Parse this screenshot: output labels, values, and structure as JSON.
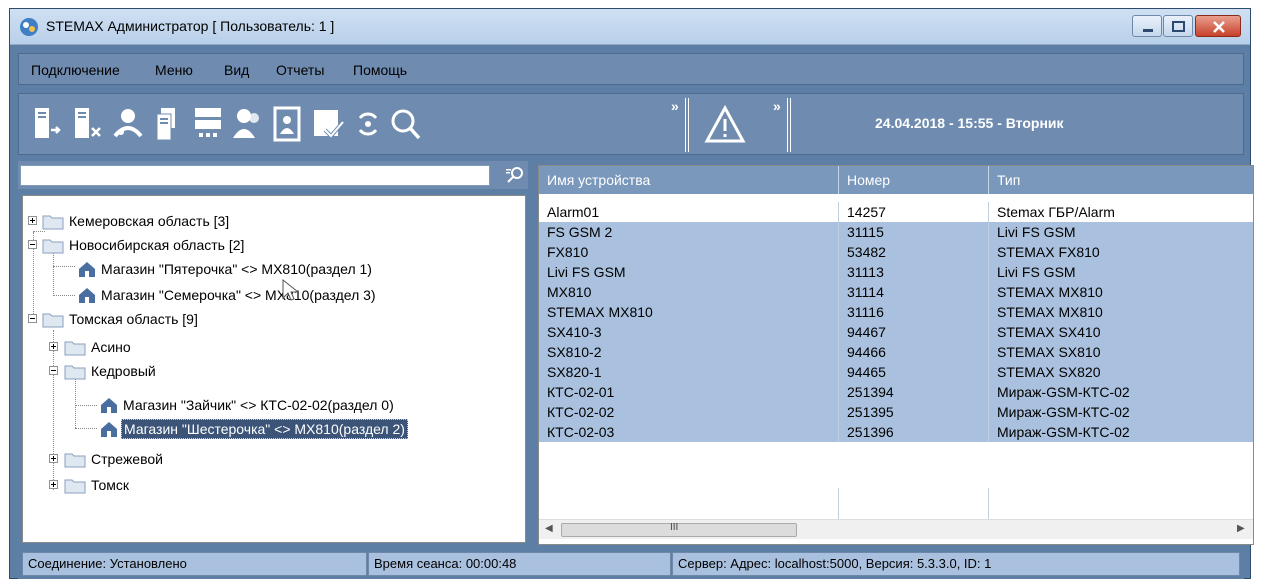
{
  "window": {
    "title": "STEMAX Администратор [ Пользователь: 1 ]"
  },
  "menu": [
    "Подключение",
    "Меню",
    "Вид",
    "Отчеты",
    "Помощь"
  ],
  "toolbar": {
    "datetime": "24.04.2018 - 15:55 - Вторник",
    "chevron": "»",
    "icons": [
      "connect-icon",
      "disconnect-icon",
      "users-icon",
      "documents-icon",
      "server-list-icon",
      "user-icon",
      "report-icon",
      "checklist-icon",
      "refresh-icon",
      "search-icon",
      "alarm-icon"
    ]
  },
  "search": {
    "value": ""
  },
  "tree": {
    "nodes": [
      {
        "label": "Кемеровская область [3]",
        "expanded": false
      },
      {
        "label": "Новосибирская область [2]",
        "expanded": true
      },
      {
        "label": "Магазин \"Пятерочка\" <> MX810(раздел 1)"
      },
      {
        "label": "Магазин \"Семерочка\" <> MX810(раздел 3)"
      },
      {
        "label": "Томская область [9]",
        "expanded": true
      },
      {
        "label": "Асино",
        "expanded": false
      },
      {
        "label": "Кедровый",
        "expanded": true
      },
      {
        "label": "Магазин \"Зайчик\" <> КТС-02-02(раздел 0)"
      },
      {
        "label": "Магазин \"Шестерочка\" <> MX810(раздел 2)",
        "selected": true
      },
      {
        "label": "Стрежевой",
        "expanded": false
      },
      {
        "label": "Томск",
        "expanded": false
      }
    ]
  },
  "table": {
    "columns": [
      "Имя устройства",
      "Номер",
      "Тип"
    ],
    "rows": [
      [
        "Alarm01",
        "14257",
        "Stemax ГБР/Alarm"
      ],
      [
        "FS GSM 2",
        "31115",
        "Livi FS GSM"
      ],
      [
        "FX810",
        "53482",
        "STEMAX FX810"
      ],
      [
        "Livi FS GSM",
        "31113",
        "Livi FS GSM"
      ],
      [
        "MX810",
        "31114",
        "STEMAX MX810"
      ],
      [
        "STEMAX MX810",
        "31116",
        "STEMAX MX810"
      ],
      [
        "SX410-3",
        "94467",
        "STEMAX SX410"
      ],
      [
        "SX810-2",
        "94466",
        "STEMAX SX810"
      ],
      [
        "SX820-1",
        "94465",
        "STEMAX SX820"
      ],
      [
        "КТС-02-01",
        "251394",
        "Мираж-GSM-КТС-02"
      ],
      [
        "КТС-02-02",
        "251395",
        "Мираж-GSM-КТС-02"
      ],
      [
        "КТС-02-03",
        "251396",
        "Мираж-GSM-КТС-02"
      ]
    ],
    "scroll_grip": "III"
  },
  "status": {
    "connection": "Соединение: Установлено",
    "session": "Время сеанса: 00:00:48",
    "server": "Сервер: Адрес: localhost:5000, Версия: 5.3.3.0, ID: 1"
  }
}
